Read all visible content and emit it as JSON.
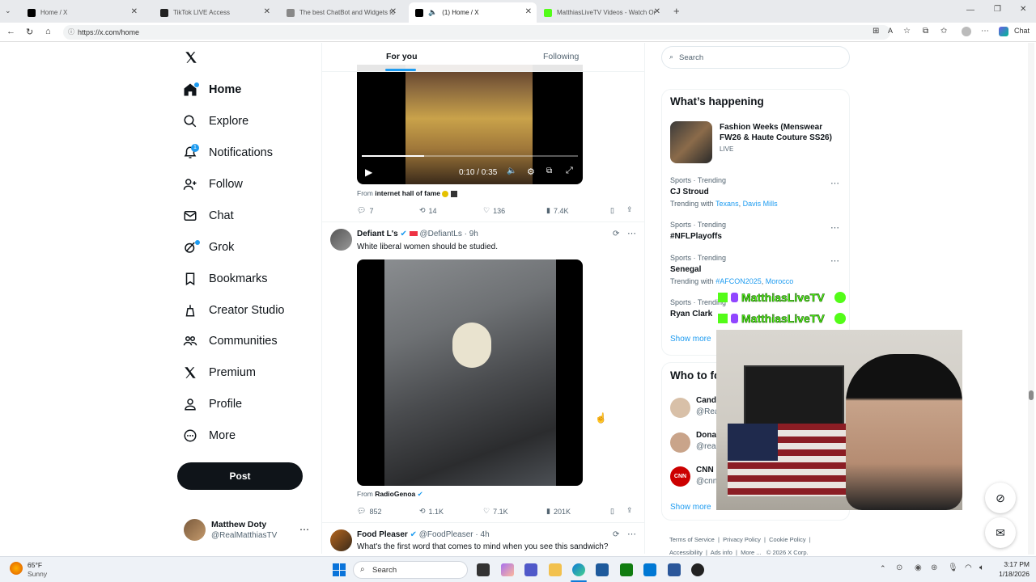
{
  "browser": {
    "tabs": [
      {
        "title": "Home / X",
        "favicon": "x-icon"
      },
      {
        "title": "TikTok LIVE Access",
        "favicon": "tiktok-icon"
      },
      {
        "title": "The best ChatBot and Widgets fo",
        "favicon": "bot-icon"
      },
      {
        "title": "(1) Home / X",
        "favicon": "x-icon"
      },
      {
        "title": "MatthiasLiveTV Videos - Watch Or",
        "favicon": "kick-icon"
      }
    ],
    "url": "https://x.com/home",
    "chat_label": "Chat"
  },
  "sidebar": {
    "items": [
      {
        "label": "Home"
      },
      {
        "label": "Explore"
      },
      {
        "label": "Notifications",
        "badge": "1"
      },
      {
        "label": "Follow"
      },
      {
        "label": "Chat"
      },
      {
        "label": "Grok"
      },
      {
        "label": "Bookmarks"
      },
      {
        "label": "Creator Studio"
      },
      {
        "label": "Communities"
      },
      {
        "label": "Premium"
      },
      {
        "label": "Profile"
      },
      {
        "label": "More"
      }
    ],
    "post_label": "Post",
    "account": {
      "name": "Matthew Doty",
      "handle": "@RealMatthiasTV"
    }
  },
  "feed": {
    "tabs": {
      "for_you": "For you",
      "following": "Following"
    },
    "video1": {
      "time": "0:10 / 0:35",
      "from_prefix": "From",
      "from": "internet hall of fame",
      "progress": 0.29
    },
    "post1_stats": {
      "replies": "7",
      "reposts": "14",
      "likes": "136",
      "views": "7.4K"
    },
    "post2": {
      "name": "Defiant L's",
      "handle": "@DefiantLs",
      "time": "· 9h",
      "text": "White liberal women should be studied.",
      "from_prefix": "From",
      "from": "RadioGenoa",
      "stats": {
        "replies": "852",
        "reposts": "1.1K",
        "likes": "7.1K",
        "views": "201K"
      }
    },
    "post3": {
      "name": "Food Pleaser",
      "handle": "@FoodPleaser",
      "time": "· 4h",
      "text": "What's the first word that comes to mind when you see this sandwich?"
    }
  },
  "right": {
    "search_placeholder": "Search",
    "whats_happening": "What’s happening",
    "event": {
      "title": "Fashion Weeks (Menswear FW26 & Haute Couture SS26)",
      "status": "LIVE"
    },
    "trends": [
      {
        "category": "Sports · Trending",
        "name": "CJ Stroud",
        "with_label": "Trending with",
        "with": [
          "Texans",
          "Davis Mills"
        ]
      },
      {
        "category": "Sports · Trending",
        "name": "#NFLPlayoffs"
      },
      {
        "category": "Sports · Trending",
        "name": "Senegal",
        "with_label": "Trending with",
        "with": [
          "#AFCON2025",
          "Morocco"
        ]
      },
      {
        "category": "Sports · Trending",
        "name": "Ryan Clark"
      }
    ],
    "show_more": "Show more",
    "who_to_follow": "Who to fo",
    "follow": [
      {
        "name": "Cand",
        "handle": "@Rea"
      },
      {
        "name": "Dona",
        "handle": "@rea"
      },
      {
        "name": "CNN",
        "handle": "@cnn"
      }
    ],
    "show_more2": "Show more",
    "footer": [
      "Terms of Service",
      "Privacy Policy",
      "Cookie Policy",
      "Accessibility",
      "Ads info",
      "More ...",
      "© 2026 X Corp."
    ]
  },
  "overlay": {
    "stream_name_1": "MatthiasLiveTV",
    "stream_name_2": "MatthiasLiveTV"
  },
  "taskbar": {
    "weather_temp": "65°F",
    "weather_desc": "Sunny",
    "search_label": "Search",
    "time": "3:17 PM",
    "date": "1/18/2026"
  },
  "colors": {
    "accent": "#1d9bf0",
    "text": "#0f1419",
    "muted": "#536471",
    "kick": "#53fc18"
  }
}
